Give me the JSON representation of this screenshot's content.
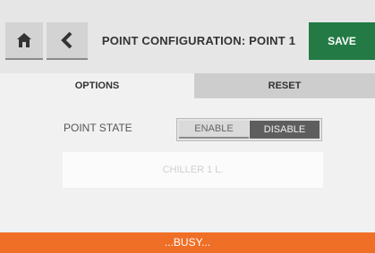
{
  "header": {
    "title": "POINT CONFIGURATION: POINT 1",
    "save_label": "SAVE",
    "home_icon": "home-icon",
    "back_icon": "chevron-left-icon"
  },
  "tabs": [
    {
      "label": "OPTIONS",
      "active": true
    },
    {
      "label": "RESET",
      "active": false
    }
  ],
  "point_state": {
    "label": "POINT STATE",
    "options": [
      "ENABLE",
      "DISABLE"
    ],
    "selected": "DISABLE"
  },
  "name_field": {
    "value": "CHILLER 1 L."
  },
  "status": {
    "text": "...BUSY..."
  },
  "colors": {
    "save": "#237a45",
    "status_bar": "#ef6f27",
    "toggle_selected": "#5e5e5e"
  }
}
